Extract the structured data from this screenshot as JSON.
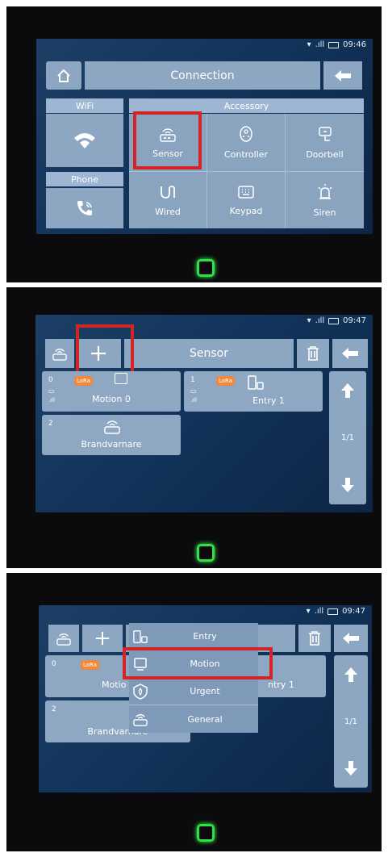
{
  "panel1": {
    "status_time": "09:46",
    "title": "Connection",
    "left_headers": {
      "wifi": "WiFi",
      "phone": "Phone"
    },
    "accessory_header": "Accessory",
    "items": {
      "sensor": "Sensor",
      "controller": "Controller",
      "doorbell": "Doorbell",
      "wired": "Wired",
      "keypad": "Keypad",
      "siren": "Siren"
    }
  },
  "panel2": {
    "status_time": "09:47",
    "title": "Sensor",
    "page_indicator": "1/1",
    "sensors": [
      {
        "index": "0",
        "badge": "LoRa",
        "label": "Motion 0"
      },
      {
        "index": "1",
        "badge": "LoRa",
        "label": "Entry 1"
      },
      {
        "index": "2",
        "label": "Brandvarnare"
      }
    ]
  },
  "panel3": {
    "status_time": "09:47",
    "page_indicator": "1/1",
    "behind": {
      "motion": "Motio",
      "entry": "ntry 1",
      "brand": "Brandvarnare",
      "index0": "0",
      "index2": "2",
      "badge": "LoRa"
    },
    "menu": {
      "entry": "Entry",
      "motion": "Motion",
      "urgent": "Urgent",
      "general": "General"
    }
  },
  "colors": {
    "highlight": "#d52424",
    "home_button": "#2fe046",
    "lora_badge": "#f08a3a"
  }
}
